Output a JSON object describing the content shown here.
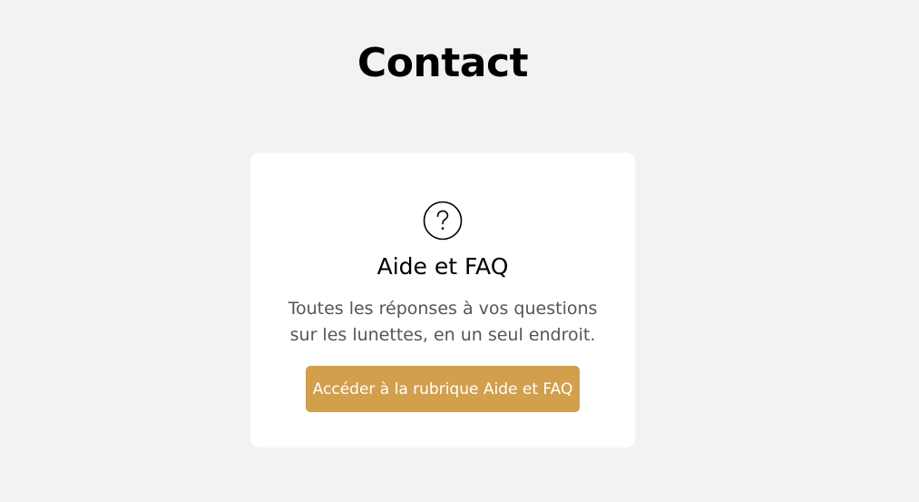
{
  "page": {
    "title": "Contact"
  },
  "help_card": {
    "icon": "question-circle-icon",
    "title": "Aide et FAQ",
    "description": "Toutes les réponses à vos questions sur les lunettes, en un seul endroit.",
    "button_label": "Accéder à la rubrique Aide et FAQ"
  },
  "colors": {
    "background": "#f2f2f2",
    "card": "#ffffff",
    "accent": "#d29f4d",
    "text_primary": "#000000",
    "text_secondary": "#555555"
  }
}
